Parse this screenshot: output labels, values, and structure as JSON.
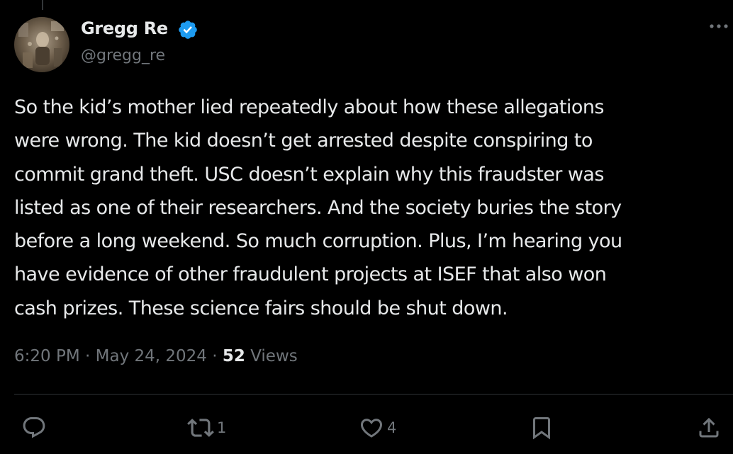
{
  "author": {
    "display_name": "Gregg Re",
    "handle": "@gregg_re",
    "verified": true,
    "avatar_icon": "profile-photo"
  },
  "tweet": {
    "text": "So the kid’s mother lied repeatedly about how these allegations\nwere wrong. The kid doesn’t get arrested despite conspiring to\ncommit grand theft. USC doesn’t explain why this fraudster was\nlisted as one of their researchers. And the society buries the story\nbefore a long weekend. So much corruption. Plus, I’m hearing you\nhave evidence of other fraudulent projects at ISEF that also won\ncash prizes. These science fairs should be shut down."
  },
  "meta": {
    "time": "6:20 PM",
    "separator": "·",
    "date": "May 24, 2024",
    "views_count": "52",
    "views_label": "Views"
  },
  "actions": {
    "reply": {
      "icon": "reply-icon"
    },
    "repost": {
      "icon": "repost-icon",
      "count": "1"
    },
    "like": {
      "icon": "heart-icon",
      "count": "4"
    },
    "bookmark": {
      "icon": "bookmark-icon"
    },
    "share": {
      "icon": "share-icon"
    }
  },
  "colors": {
    "background": "#000000",
    "text_primary": "#e7e9ea",
    "text_secondary": "#71767b",
    "verified_blue": "#1d9bf0",
    "divider": "#2f3336"
  }
}
